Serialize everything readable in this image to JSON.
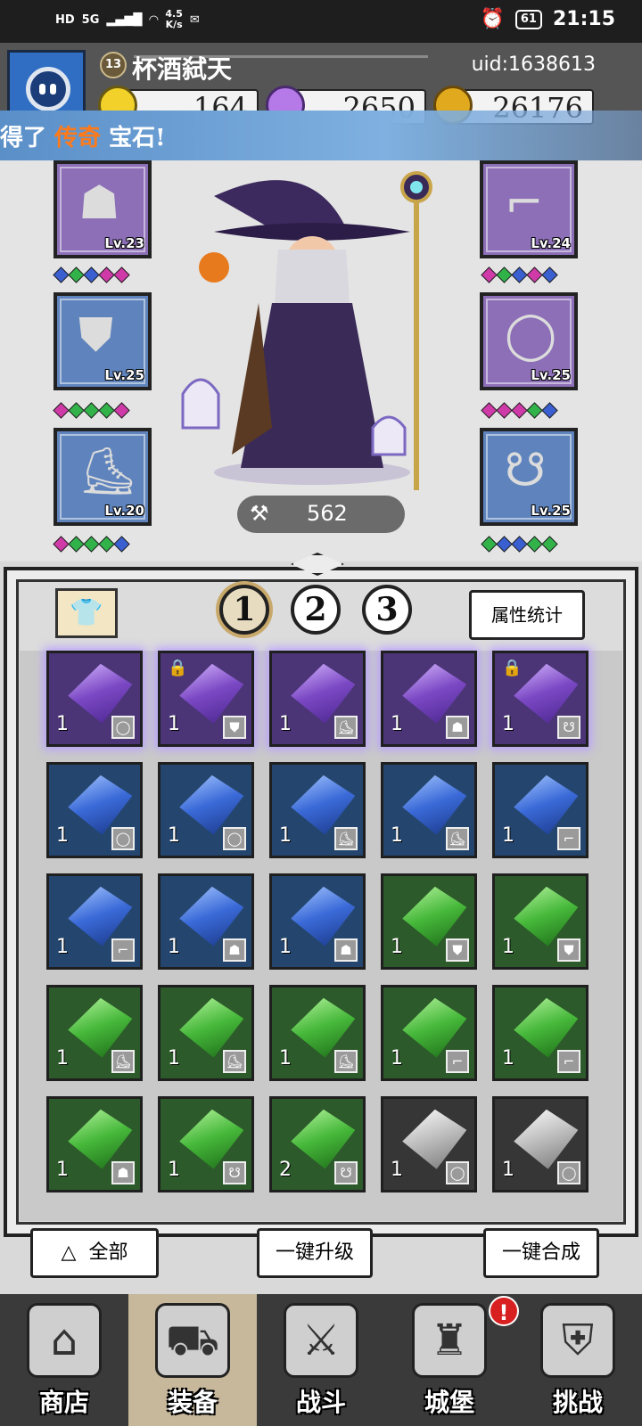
{
  "status_bar": {
    "hd": "HD",
    "network": "5G",
    "speed_value": "4.5",
    "speed_unit": "K/s",
    "battery": "61",
    "time": "21:15"
  },
  "header": {
    "level": "13",
    "player_name": "杯酒弑天",
    "uid": "uid:1638613",
    "resources": {
      "energy": "164",
      "diamonds": "2650",
      "gold": "26176"
    }
  },
  "banner": {
    "prefix": "得了",
    "highlight": "传奇",
    "suffix": "宝石!"
  },
  "equipment": {
    "left": [
      {
        "icon": "hood",
        "level": "Lv.23",
        "color": "purple",
        "gems": [
          "#3a5fd0",
          "#32b34a",
          "#3a5fd0",
          "#d03aa8",
          "#d03aa8"
        ]
      },
      {
        "icon": "cape",
        "level": "Lv.25",
        "color": "blue",
        "gems": [
          "#d03aa8",
          "#32b34a",
          "#32b34a",
          "#32b34a",
          "#d03aa8"
        ]
      },
      {
        "icon": "boot",
        "level": "Lv.20",
        "color": "blue",
        "gems": [
          "#d03aa8",
          "#32b34a",
          "#32b34a",
          "#32b34a",
          "#3a5fd0"
        ]
      }
    ],
    "right": [
      {
        "icon": "pipe",
        "level": "Lv.24",
        "color": "purple",
        "gems": [
          "#d03aa8",
          "#32b34a",
          "#3a5fd0",
          "#d03aa8",
          "#3a5fd0"
        ]
      },
      {
        "icon": "ring",
        "level": "Lv.25",
        "color": "purple",
        "gems": [
          "#d03aa8",
          "#d03aa8",
          "#d03aa8",
          "#32b34a",
          "#3a5fd0"
        ]
      },
      {
        "icon": "necklace",
        "level": "Lv.25",
        "color": "blue",
        "gems": [
          "#32b34a",
          "#3a5fd0",
          "#3a5fd0",
          "#32b34a",
          "#32b34a"
        ]
      }
    ]
  },
  "power": {
    "value": "562"
  },
  "panel": {
    "pages": [
      "1",
      "2",
      "3"
    ],
    "active_page": "1",
    "stats_label": "属性统计"
  },
  "gems_grid": [
    {
      "color": "purple",
      "count": "1",
      "slot": "ring-icon",
      "locked": false
    },
    {
      "color": "purple",
      "count": "1",
      "slot": "cape-icon",
      "locked": true
    },
    {
      "color": "purple",
      "count": "1",
      "slot": "boot-icon",
      "locked": false
    },
    {
      "color": "purple",
      "count": "1",
      "slot": "hood-icon",
      "locked": false
    },
    {
      "color": "purple",
      "count": "1",
      "slot": "necklace-icon",
      "locked": true
    },
    {
      "color": "blue",
      "count": "1",
      "slot": "ring-icon",
      "locked": false
    },
    {
      "color": "blue",
      "count": "1",
      "slot": "ring-icon",
      "locked": false
    },
    {
      "color": "blue",
      "count": "1",
      "slot": "boot-icon",
      "locked": false
    },
    {
      "color": "blue",
      "count": "1",
      "slot": "boot-icon",
      "locked": false
    },
    {
      "color": "blue",
      "count": "1",
      "slot": "pipe-icon",
      "locked": false
    },
    {
      "color": "blue",
      "count": "1",
      "slot": "pipe-icon",
      "locked": false
    },
    {
      "color": "blue",
      "count": "1",
      "slot": "hood-icon",
      "locked": false
    },
    {
      "color": "blue",
      "count": "1",
      "slot": "hood-icon",
      "locked": false
    },
    {
      "color": "green",
      "count": "1",
      "slot": "cape-icon",
      "locked": false
    },
    {
      "color": "green",
      "count": "1",
      "slot": "cape-icon",
      "locked": false
    },
    {
      "color": "green",
      "count": "1",
      "slot": "boot-icon",
      "locked": false
    },
    {
      "color": "green",
      "count": "1",
      "slot": "boot-icon",
      "locked": false
    },
    {
      "color": "green",
      "count": "1",
      "slot": "boot-icon",
      "locked": false
    },
    {
      "color": "green",
      "count": "1",
      "slot": "pipe-icon",
      "locked": false
    },
    {
      "color": "green",
      "count": "1",
      "slot": "pipe-icon",
      "locked": false
    },
    {
      "color": "green",
      "count": "1",
      "slot": "hood-icon",
      "locked": false
    },
    {
      "color": "green",
      "count": "1",
      "slot": "necklace-icon",
      "locked": false
    },
    {
      "color": "green",
      "count": "2",
      "slot": "necklace-icon",
      "locked": false
    },
    {
      "color": "gray",
      "count": "1",
      "slot": "ring-icon",
      "locked": false
    },
    {
      "color": "gray",
      "count": "1",
      "slot": "ring-icon",
      "locked": false
    }
  ],
  "actions": {
    "filter_all": "全部",
    "upgrade_all": "一键升级",
    "merge_all": "一键合成"
  },
  "nav": [
    {
      "label": "商店",
      "icon": "shop-icon",
      "glyph": "⌂"
    },
    {
      "label": "装备",
      "icon": "bag-icon",
      "glyph": "⛟"
    },
    {
      "label": "战斗",
      "icon": "swords-icon",
      "glyph": "⚔"
    },
    {
      "label": "城堡",
      "icon": "castle-icon",
      "glyph": "♜"
    },
    {
      "label": "挑战",
      "icon": "shield-icon",
      "glyph": "⛨"
    }
  ],
  "alert_badge": "!"
}
